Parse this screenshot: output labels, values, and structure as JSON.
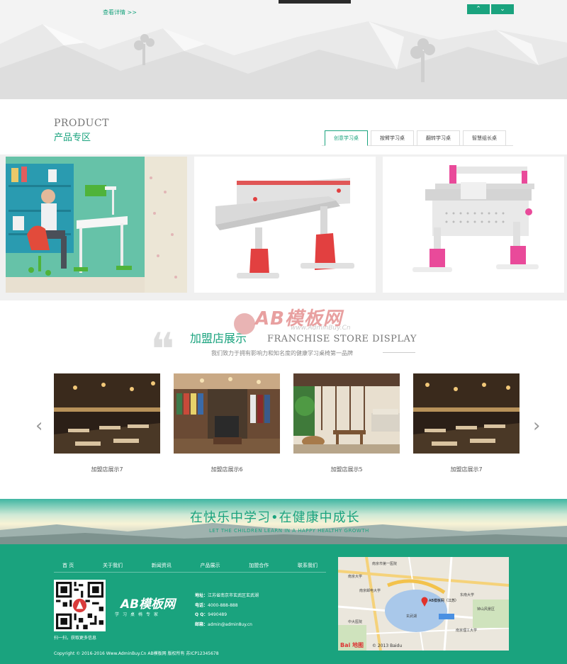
{
  "hero": {
    "more_link": "查看详情 >>",
    "nav_up": "⌃",
    "nav_down": "⌄"
  },
  "product": {
    "title_en": "PRODUCT",
    "title_cn": "产品专区",
    "tabs": [
      {
        "label": "创意学习桌",
        "active": true
      },
      {
        "label": "按臂学习桌",
        "active": false
      },
      {
        "label": "翻转学习桌",
        "active": false
      },
      {
        "label": "智慧组长桌",
        "active": false
      }
    ]
  },
  "franchise": {
    "title_cn": "加盟店展示",
    "title_en": "FRANCHISE STORE DISPLAY",
    "subtitle": "我们致力于拥有影响力和知名度的健康学习桌椅第一品牌",
    "prev_arrow": "‹",
    "next_arrow": "›",
    "stores": [
      {
        "label": "加盟店展示7"
      },
      {
        "label": "加盟店展示6"
      },
      {
        "label": "加盟店展示5"
      },
      {
        "label": "加盟店展示7"
      }
    ]
  },
  "watermark": {
    "text": "AB模板网",
    "url": "www.AdminBuy.Cn"
  },
  "banner": {
    "slogan_cn": "在快乐中学习•在健康中成长",
    "slogan_en": "LET THE CHILDREN LEARN IN A HAPPY HEALTHY GROWTH"
  },
  "footer": {
    "nav": [
      "首 页",
      "关于我们",
      "新闻资讯",
      "产品展示",
      "加盟合作",
      "联系我们"
    ],
    "qr_caption": "扫一扫，获取更多信息",
    "logo": "AB模板网",
    "logo_sub": "学习桌椅专家",
    "contact": [
      {
        "label": "地址：",
        "value": "江苏省南京市玄武区玄武湖"
      },
      {
        "label": "电话：",
        "value": "4000-888-888"
      },
      {
        "label": "Q Q：",
        "value": "9490489"
      },
      {
        "label": "邮箱：",
        "value": "admin@admin8uy.cn"
      }
    ],
    "copyright": "Copyright © 2016-2016 Www.AdminBuy.Cn AB模板网 版权所有 苏ICP12345678",
    "map": {
      "brand": "Bai 地图",
      "copyright": "© 2013 Baidu",
      "marker_label": "AB模板网（江苏）",
      "labels": [
        "南京市第一医院",
        "南京大学",
        "南京邮电大学",
        "玄武湖",
        "东南大学",
        "钟山风景区",
        "中大医院",
        "南京理工大学"
      ]
    }
  }
}
